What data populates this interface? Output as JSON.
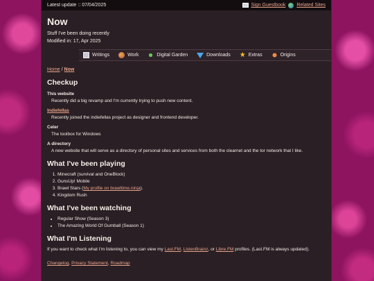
{
  "topbar": {
    "update": "Latest update :: 07/04/2025",
    "guestbook": "Sign Guestbook",
    "related": "Related Sites"
  },
  "header": {
    "title": "Now",
    "subtitle": "Stuff I've been doing recently",
    "modified": "Modified in: 17, Apr 2025"
  },
  "nav": [
    {
      "label": "Writings",
      "icon": "writing-icon"
    },
    {
      "label": "Work",
      "icon": "work-icon"
    },
    {
      "label": "Digital Garden",
      "icon": "plant-icon"
    },
    {
      "label": "Downloads",
      "icon": "download-arrow-icon"
    },
    {
      "label": "Extras",
      "icon": "star-icon"
    },
    {
      "label": "Origins",
      "icon": "origin-icon"
    }
  ],
  "breadcrumb": {
    "home": "Home",
    "sep": "/",
    "current": "Now"
  },
  "checkup": {
    "heading": "Checkup",
    "items": [
      {
        "title": "This website",
        "desc": "Recently did a big revamp and I'm currently trying to push new content."
      },
      {
        "title": "Indiefellas",
        "desc": "Recently joined the indiefellas project as designer and frontend developer."
      },
      {
        "title": "Celer",
        "desc": "The toolbox for Windows"
      },
      {
        "title": "A directory",
        "desc": "A new website that will serve as a directory of personal sites and services from both the clearnet and the tor network that I like."
      }
    ]
  },
  "playing": {
    "heading": "What I've been playing",
    "items": [
      "Minecraft (survival and OneBlock)",
      "GunsUp! Mobile",
      "Brawl Stars (",
      "Kingdom Rush"
    ],
    "brawl_link": "My profile on brawltime.ninja",
    "brawl_suffix": ")."
  },
  "watching": {
    "heading": "What I've been watching",
    "items": [
      "Regular Show (Season 3)",
      "The Amazing World Of Gumball (Season 1)"
    ]
  },
  "listening": {
    "heading": "What I'm Listening",
    "pre": "If you want to check what I'm listening to, you can view my ",
    "lastfm": "Last.FM",
    "comma1": ", ",
    "listenbrainz": "ListenBrainz",
    "or": ", or ",
    "librefm": "Libre.FM",
    "post": " profiles. (Last.FM is always updated)."
  },
  "footer": {
    "changelog": "Changelog",
    "privacy": "Privacy Statement",
    "roadmap": "Roadmap"
  }
}
